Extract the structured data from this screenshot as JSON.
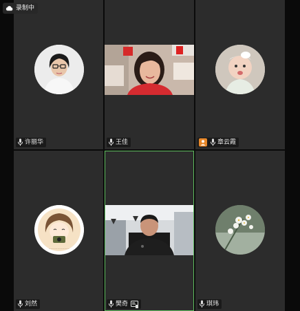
{
  "recording": {
    "label": "录制中",
    "icon": "cloud-icon"
  },
  "participants": [
    {
      "name": "许丽华",
      "type": "avatar",
      "muted": false,
      "host": false
    },
    {
      "name": "王佳",
      "type": "video",
      "muted": false,
      "host": false
    },
    {
      "name": "章云霞",
      "type": "avatar",
      "muted": false,
      "host": true
    },
    {
      "name": "刘然",
      "type": "avatar",
      "muted": false,
      "host": false
    },
    {
      "name": "樊奇",
      "type": "video",
      "muted": false,
      "host": false,
      "active_speaker": true,
      "screen_share_icon": true
    },
    {
      "name": "琪玮",
      "type": "avatar",
      "muted": false,
      "host": false
    }
  ],
  "colors": {
    "tile_bg": "#2c2c2c",
    "active_border": "#5fbf5f",
    "host_badge": "#e8882a"
  }
}
